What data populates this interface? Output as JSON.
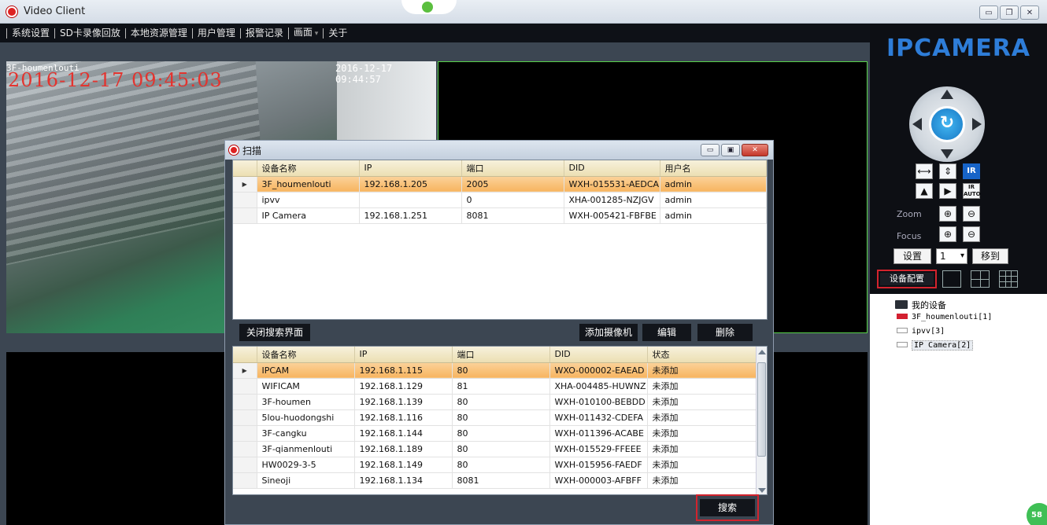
{
  "window": {
    "title": "Video Client"
  },
  "menu": [
    "系统设置",
    "SD卡录像回放",
    "本地资源管理",
    "用户管理",
    "报警记录",
    "画面",
    "关于"
  ],
  "video": {
    "camera_label": "3F-houmenlouti",
    "osd_time": "2016-12-17 09:45:03",
    "timestamp": "2016-12-17 09:44:57"
  },
  "brand": "IPCAMERA",
  "ptz": {
    "zoom_label": "Zoom",
    "focus_label": "Focus",
    "ir_label": "IR",
    "ir_auto_label": "IR AUTO",
    "set_label": "设置",
    "preset_value": "1",
    "goto_label": "移到"
  },
  "device_config_label": "设备配置",
  "tree": {
    "root": "我的设备",
    "items": [
      "3F_houmenlouti[1]",
      "ipvv[3]",
      "IP Camera[2]"
    ]
  },
  "dialog": {
    "title": "扫描",
    "close_search_label": "关闭搜索界面",
    "add_camera_label": "添加摄像机",
    "edit_label": "编辑",
    "delete_label": "删除",
    "search_label": "搜索",
    "added_columns": [
      "设备名称",
      "IP",
      "端口",
      "DID",
      "用户名"
    ],
    "added_rows": [
      [
        "3F_houmenlouti",
        "192.168.1.205",
        "2005",
        "WXH-015531-AEDCA",
        "admin"
      ],
      [
        "ipvv",
        "",
        "0",
        "XHA-001285-NZJGV",
        "admin"
      ],
      [
        "IP Camera",
        "192.168.1.251",
        "8081",
        "WXH-005421-FBFBE",
        "admin"
      ]
    ],
    "found_columns": [
      "设备名称",
      "IP",
      "端口",
      "DID",
      "状态"
    ],
    "found_rows": [
      [
        "IPCAM",
        "192.168.1.115",
        "80",
        "WXO-000002-EAEAD",
        "未添加"
      ],
      [
        "WIFICAM",
        "192.168.1.129",
        "81",
        "XHA-004485-HUWNZ",
        "未添加"
      ],
      [
        "3F-houmen",
        "192.168.1.139",
        "80",
        "WXH-010100-BEBDD",
        "未添加"
      ],
      [
        "5lou-huodongshi",
        "192.168.1.116",
        "80",
        "WXH-011432-CDEFA",
        "未添加"
      ],
      [
        "3F-cangku",
        "192.168.1.144",
        "80",
        "WXH-011396-ACABE",
        "未添加"
      ],
      [
        "3F-qianmenlouti",
        "192.168.1.189",
        "80",
        "WXH-015529-FFEEE",
        "未添加"
      ],
      [
        "HW0029-3-5",
        "192.168.1.149",
        "80",
        "WXH-015956-FAEDF",
        "未添加"
      ],
      [
        "Sineoji",
        "192.168.1.134",
        "8081",
        "WXH-000003-AFBFF",
        "未添加"
      ]
    ]
  },
  "corner_badge": "58"
}
